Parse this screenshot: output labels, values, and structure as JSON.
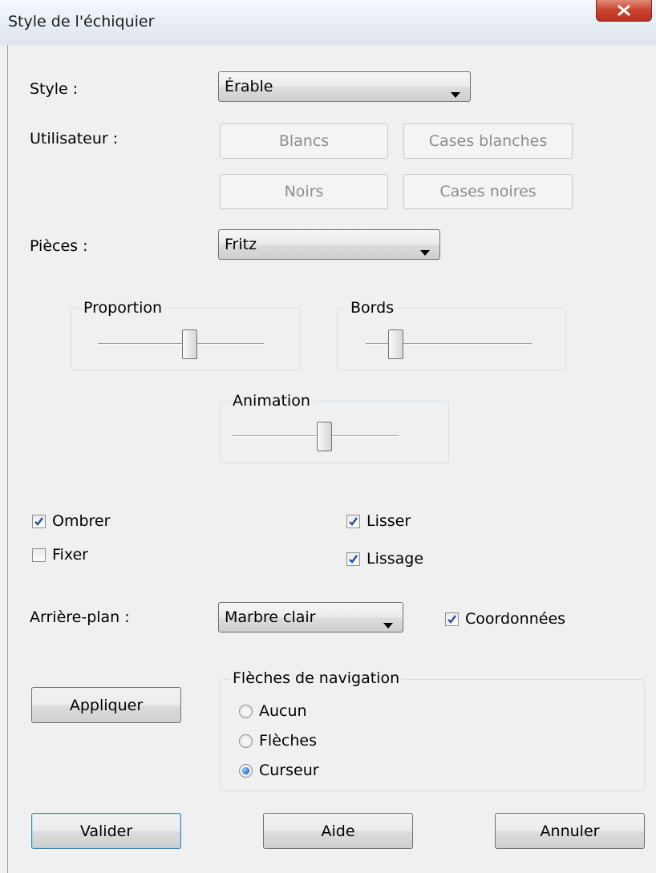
{
  "window": {
    "title": "Style de l'échiquier"
  },
  "style": {
    "label": "Style :",
    "value": "Érable"
  },
  "utilisateur": {
    "label": "Utilisateur :",
    "blancs": "Blancs",
    "cases_blanches": "Cases blanches",
    "noirs": "Noirs",
    "cases_noires": "Cases noires"
  },
  "pieces": {
    "label": "Pièces :",
    "value": "Fritz"
  },
  "sliders": {
    "proportion": {
      "label": "Proportion",
      "value": 0.55
    },
    "bords": {
      "label": "Bords",
      "value": 0.18
    },
    "animation": {
      "label": "Animation",
      "value": 0.55
    }
  },
  "checkboxes": {
    "ombrer": {
      "label": "Ombrer",
      "checked": true
    },
    "fixer": {
      "label": "Fixer",
      "checked": false
    },
    "lisser": {
      "label": "Lisser",
      "checked": true
    },
    "lissage": {
      "label": "Lissage",
      "checked": true
    },
    "coordonnees": {
      "label": "Coordonnées",
      "checked": true
    }
  },
  "arriere_plan": {
    "label": "Arrière-plan :",
    "value": "Marbre clair"
  },
  "navigation": {
    "title": "Flèches de navigation",
    "options": [
      {
        "label": "Aucun",
        "selected": false
      },
      {
        "label": "Flèches",
        "selected": false
      },
      {
        "label": "Curseur",
        "selected": true
      }
    ]
  },
  "buttons": {
    "appliquer": "Appliquer",
    "valider": "Valider",
    "aide": "Aide",
    "annuler": "Annuler"
  },
  "icons": {
    "close": "close-icon",
    "dropdown": "chevron-down-icon",
    "check": "checkmark-icon"
  },
  "colors": {
    "accent": "#1e6fb8",
    "close_button": "#c9432d",
    "check": "#2a4f9a"
  }
}
